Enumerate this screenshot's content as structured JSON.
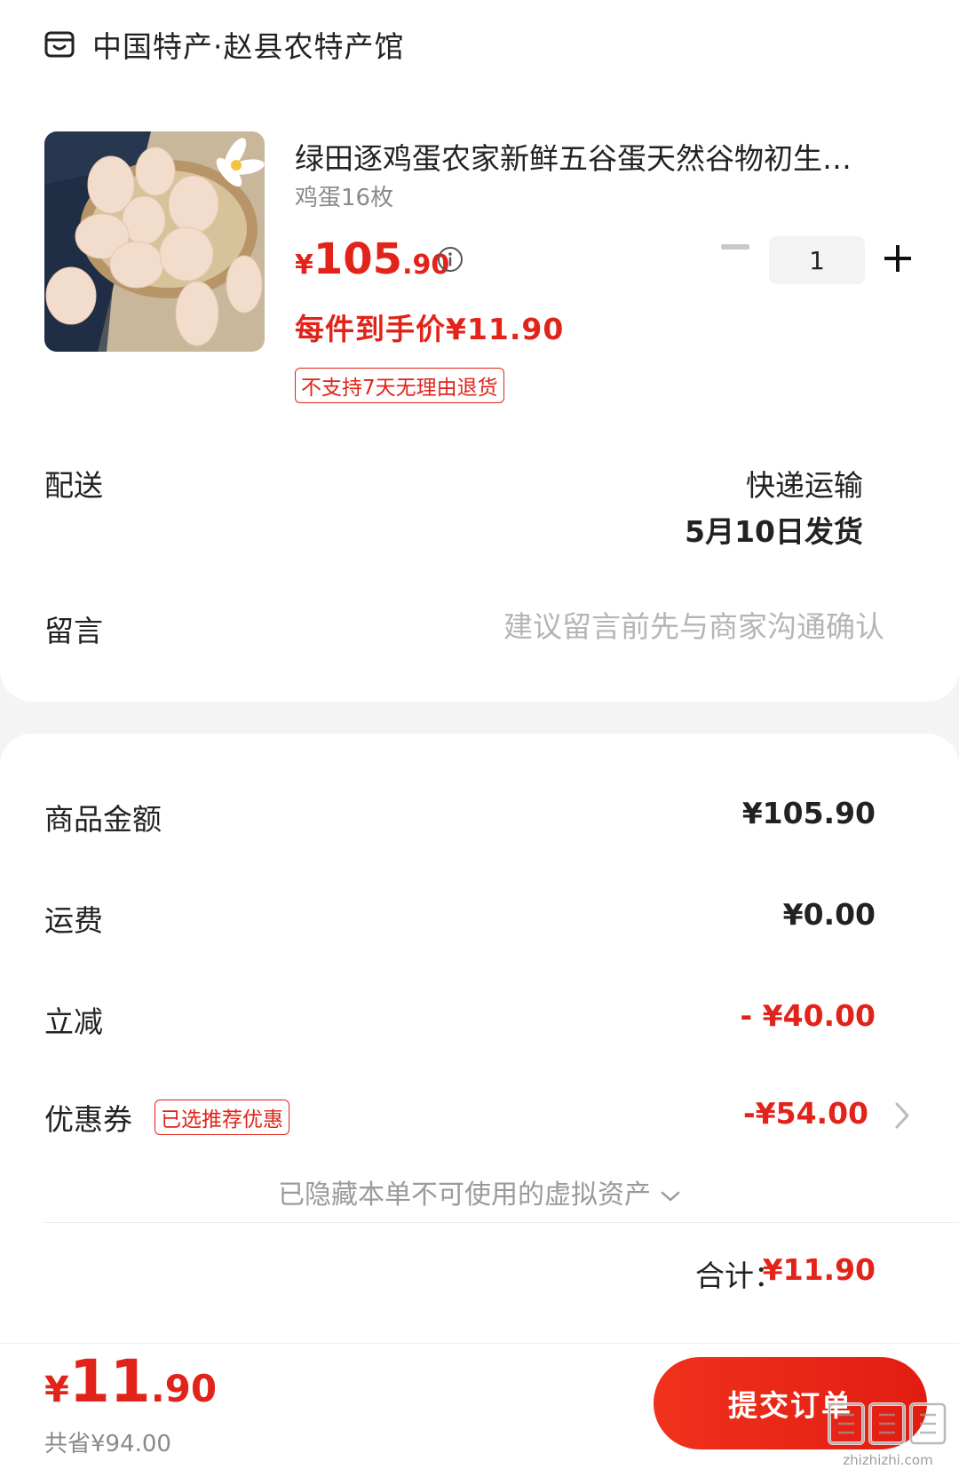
{
  "shop": {
    "name": "中国特产·赵县农特产馆",
    "icon": "store-icon"
  },
  "product": {
    "title": "绿田逐鸡蛋农家新鲜五谷蛋天然谷物初生…",
    "spec": "鸡蛋16枚",
    "price_symbol": "¥",
    "price_int": "105",
    "price_dec": ".90",
    "unit_price": "每件到手价¥11.90",
    "return_tag": "不支持7天无理由退货",
    "quantity": "1"
  },
  "delivery": {
    "label": "配送",
    "method": "快递运输",
    "ship_date": "5月10日发货"
  },
  "message": {
    "label": "留言",
    "placeholder": "建议留言前先与商家沟通确认"
  },
  "summary": {
    "goods_label": "商品金额",
    "goods_value": "¥105.90",
    "shipping_label": "运费",
    "shipping_value": "¥0.00",
    "discount_label": "立减",
    "discount_value": "- ¥40.00",
    "coupon_label": "优惠券",
    "coupon_tag": "已选推荐优惠",
    "coupon_value": "-¥54.00",
    "hidden_assets": "已隐藏本单不可使用的虚拟资产",
    "total_label": "合计：",
    "total_value": "¥11.90"
  },
  "bottom": {
    "price_symbol": "¥",
    "price_int": "11",
    "price_dec": ".90",
    "saved": "共省¥94.00",
    "submit_label": "提交订单"
  },
  "watermark": {
    "domain": "zhizhizhi.com"
  },
  "colors": {
    "accent": "#e2231a",
    "muted": "#8a8a8a"
  }
}
